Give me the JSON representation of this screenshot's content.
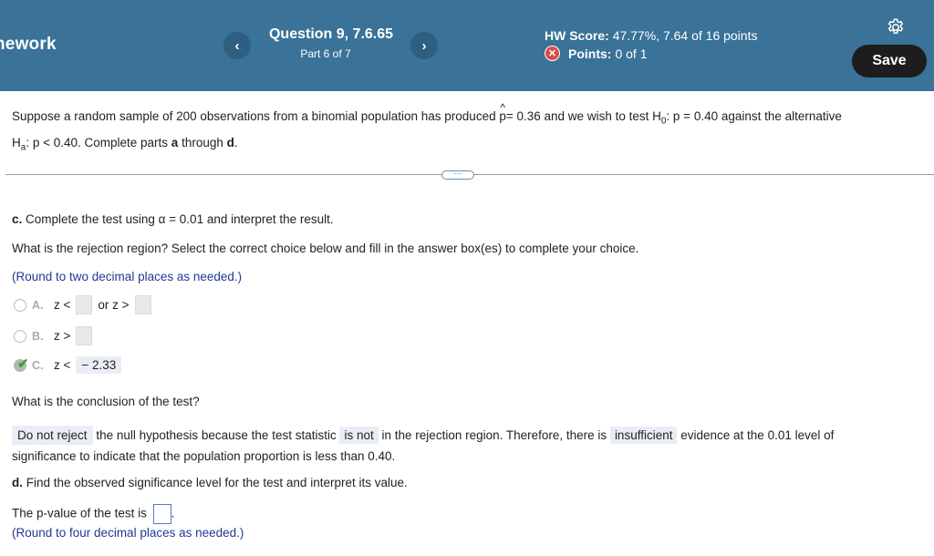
{
  "header": {
    "app_name": "nework",
    "prev_label": "‹",
    "next_label": "›",
    "question_title": "Question 9, 7.6.65",
    "question_part": "Part 6 of 7",
    "hw_score_label": "HW Score:",
    "hw_score_value": "47.77%, 7.64 of 16 points",
    "points_label": "Points:",
    "points_value": "0 of 1",
    "save_label": "Save",
    "icons": [
      "chevron-left-icon",
      "chevron-right-icon",
      "close-circle-icon",
      "gear-icon"
    ],
    "colors": {
      "header_bg": "#3a7298",
      "save_bg": "#1d1d1d",
      "error_red": "#d84b4b"
    }
  },
  "problem": {
    "line1_a": "Suppose a random sample of 200 observations from a binomial population has produced",
    "p_hat": "p",
    "line1_b": "= 0.36 and we wish to test H",
    "h0_sub": "0",
    "line1_c": ": p = 0.40 against the alternative",
    "ha": "H",
    "ha_sub": "a",
    "line2_a": ": p < 0.40. Complete parts",
    "part_a": "a",
    "line2_b": "through",
    "part_d": "d",
    "line2_end": "."
  },
  "more_label": "⋯",
  "part_c": {
    "label": "c.",
    "text": "Complete the test using α = 0.01 and interpret the result.",
    "question": "What is the rejection region? Select the correct choice below and fill in the answer box(es) to complete your choice.",
    "round_note": "(Round to two decimal places as needed.)",
    "choices": [
      {
        "letter": "A.",
        "lhs": "z <",
        "mid": "or z >"
      },
      {
        "letter": "B.",
        "lhs": "z >"
      },
      {
        "letter": "C.",
        "lhs": "z <",
        "value": "− 2.33"
      }
    ],
    "conclusion_q": "What is the conclusion of the test?",
    "sel1": "Do not reject",
    "text1": "the null hypothesis because the test statistic",
    "sel2": "is not",
    "text2": "in the rejection region. Therefore, there is",
    "sel3": "insufficient",
    "text3": "evidence at the 0.01 level of",
    "text4": "significance to indicate that the population proportion is less than 0.40."
  },
  "part_d": {
    "label": "d.",
    "text": "Find the observed significance level for the test and interpret its value.",
    "pvalue_text": "The p-value of the test is",
    "pvalue_end": ".",
    "round_note": "(Round to four decimal places as needed.)"
  }
}
